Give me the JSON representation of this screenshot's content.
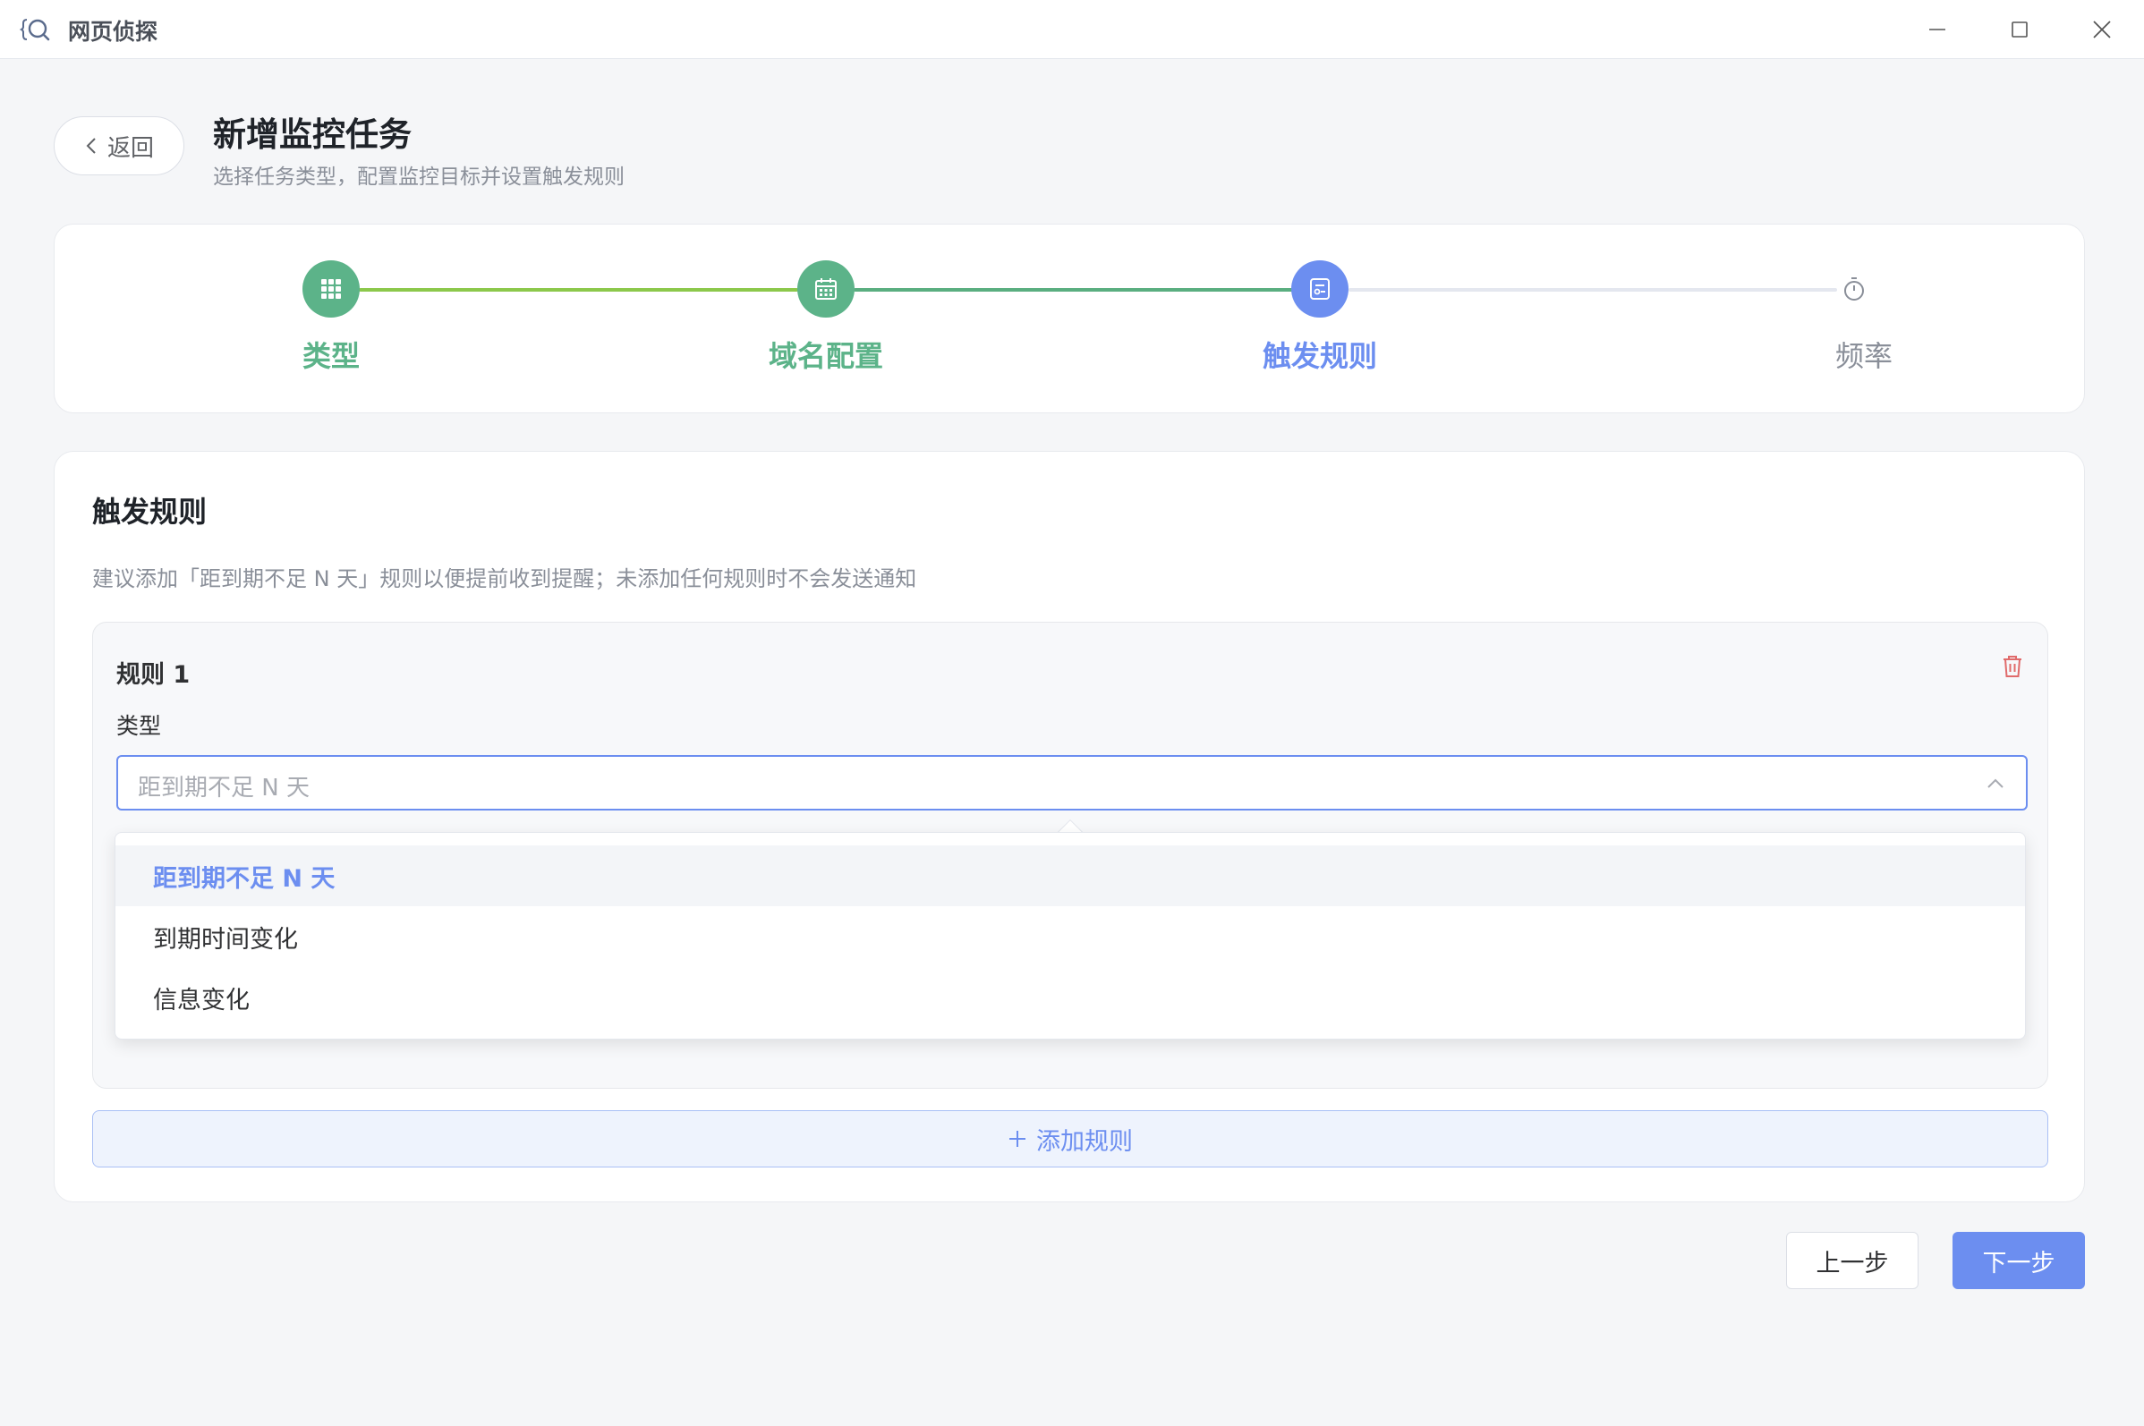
{
  "app": {
    "title": "网页侦探"
  },
  "header": {
    "back_label": "返回",
    "title": "新增监控任务",
    "subtitle": "选择任务类型，配置监控目标并设置触发规则"
  },
  "steps": [
    {
      "label": "类型",
      "status": "done"
    },
    {
      "label": "域名配置",
      "status": "done"
    },
    {
      "label": "触发规则",
      "status": "active"
    },
    {
      "label": "频率",
      "status": "pending"
    }
  ],
  "rules_section": {
    "title": "触发规则",
    "hint": "建议添加「距到期不足 N 天」规则以便提前收到提醒；未添加任何规则时不会发送通知",
    "rule": {
      "title": "规则 1",
      "type_label": "类型",
      "select_placeholder": "距到期不足 N 天",
      "options": [
        "距到期不足 N 天",
        "到期时间变化",
        "信息变化"
      ],
      "highlighted_option": "距到期不足 N 天"
    },
    "add_rule_label": "添加规则"
  },
  "footer": {
    "prev_label": "上一步",
    "next_label": "下一步"
  },
  "colors": {
    "accent": "#6c8ef0",
    "success": "#5cb389",
    "danger": "#e06b6b"
  }
}
